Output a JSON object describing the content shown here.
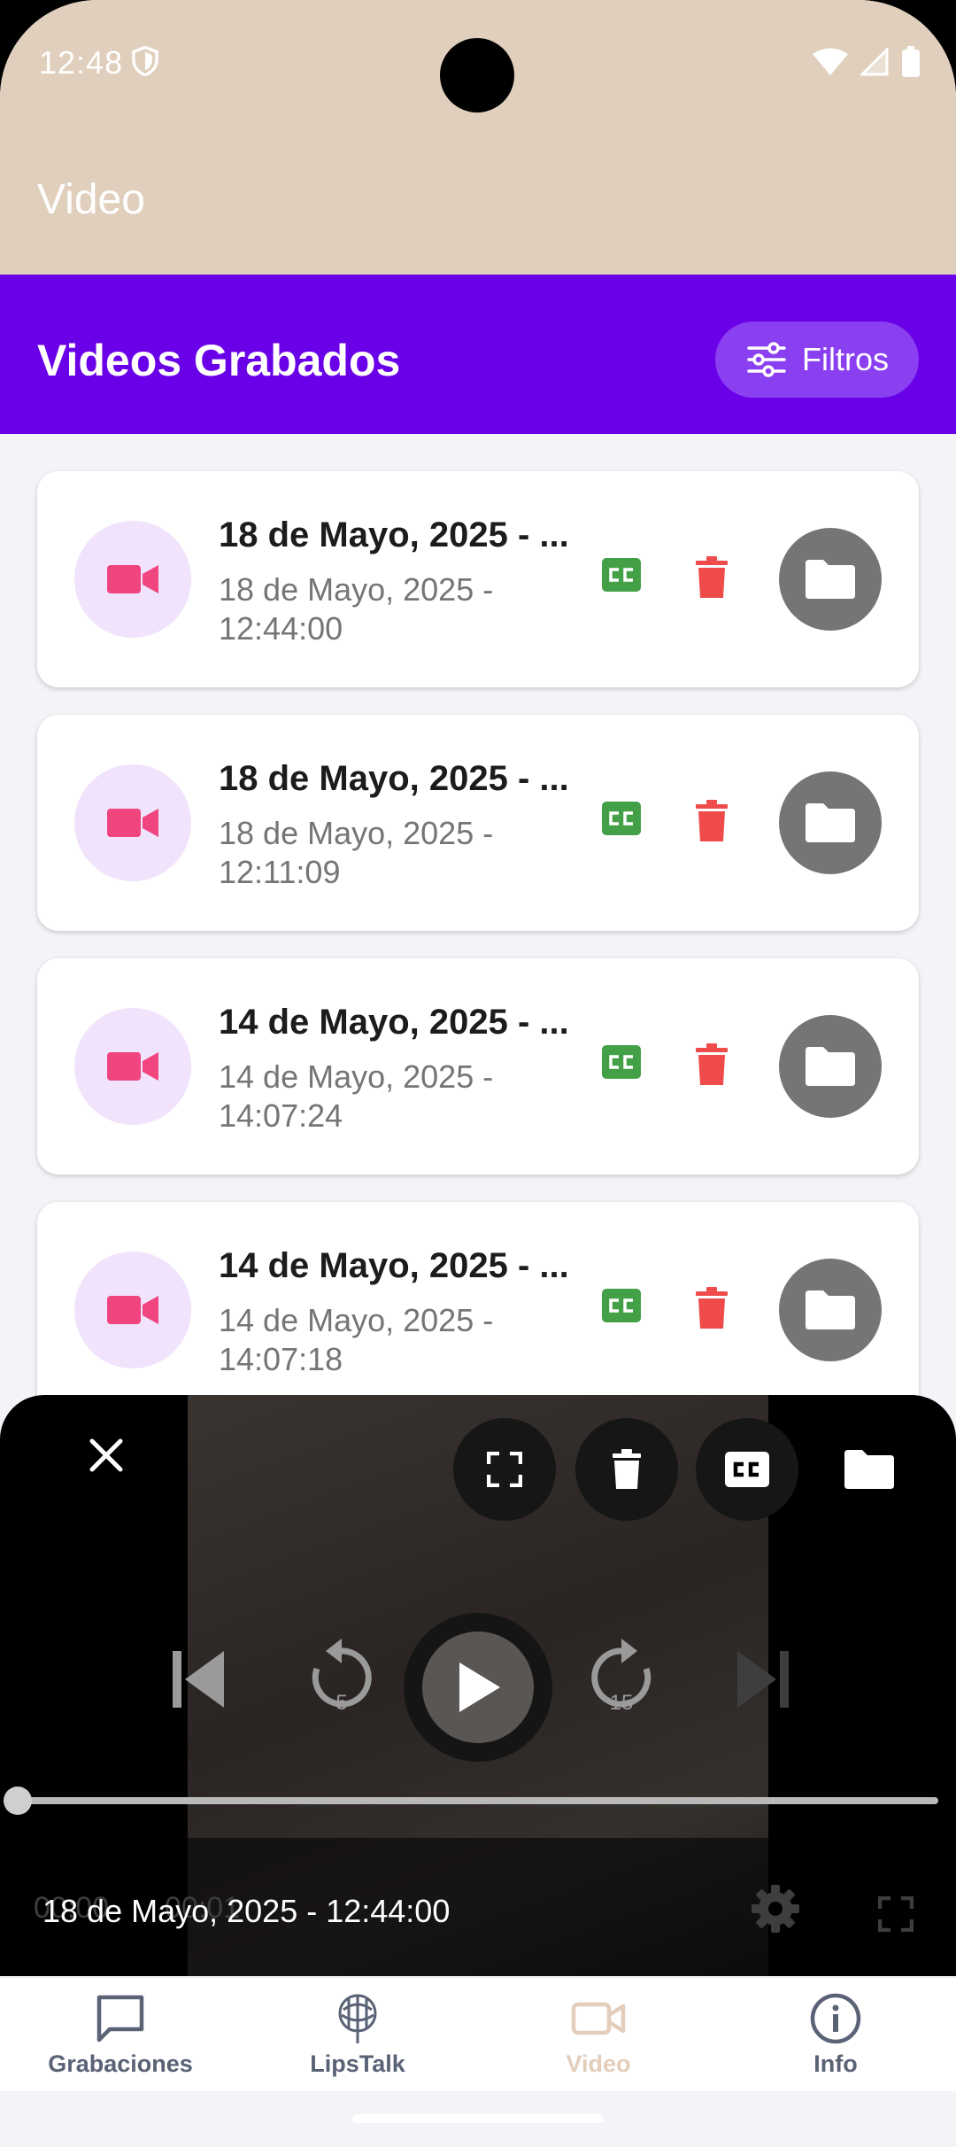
{
  "status_bar": {
    "time": "12:48"
  },
  "app_bar": {
    "title": "Video"
  },
  "header": {
    "title": "Videos Grabados",
    "filter_label": "Filtros"
  },
  "videos": [
    {
      "title": "18 de Mayo, 2025 - ...",
      "date": "18 de Mayo, 2025 -",
      "time": "12:44:00"
    },
    {
      "title": "18 de Mayo, 2025 - ...",
      "date": "18 de Mayo, 2025 -",
      "time": "12:11:09"
    },
    {
      "title": "14 de Mayo, 2025 - ...",
      "date": "14 de Mayo, 2025 -",
      "time": "14:07:24"
    },
    {
      "title": "14 de Mayo, 2025 - ...",
      "date": "14 de Mayo, 2025 -",
      "time": "14:07:18"
    }
  ],
  "player": {
    "caption": "18 de Mayo, 2025 - 12:44:00",
    "current_time": "00:00",
    "duration": "00:01",
    "rewind_seconds": "5",
    "forward_seconds": "15",
    "progress": 0
  },
  "nav": {
    "items": [
      {
        "label": "Grabaciones",
        "icon": "chat-bubble-icon"
      },
      {
        "label": "LipsTalk",
        "icon": "lipstalk-logo-icon"
      },
      {
        "label": "Video",
        "icon": "video-camera-icon"
      },
      {
        "label": "Info",
        "icon": "info-icon"
      }
    ],
    "active_index": 2
  },
  "colors": {
    "header": "#6a00e8",
    "top_bar": "#e1cfbd",
    "video_icon": "#f0457f",
    "cc_badge": "#43a047",
    "trash": "#ef4b4b",
    "folder_button": "#757575"
  }
}
